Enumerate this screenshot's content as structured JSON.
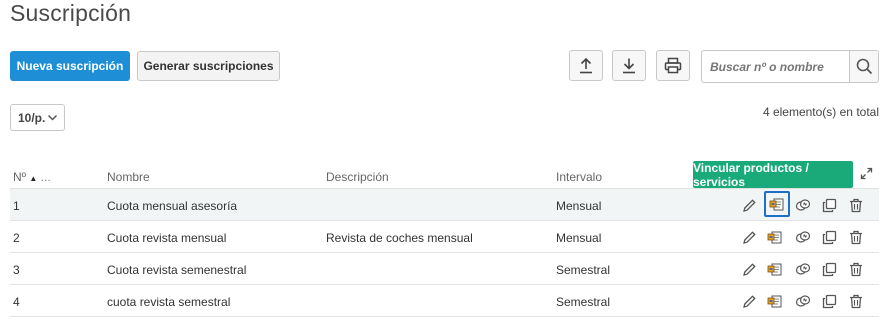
{
  "page": {
    "title": "Suscripción"
  },
  "toolbar": {
    "new_label": "Nueva suscripción",
    "generate_label": "Generar suscripciones",
    "search_placeholder": "Buscar nº o nombre"
  },
  "pagination": {
    "page_size": "10/p.",
    "total_text": "4 elemento(s) en total"
  },
  "table": {
    "headers": {
      "num": "Nº",
      "name": "Nombre",
      "description": "Descripción",
      "interval": "Intervalo"
    },
    "num_sort_extra": "...",
    "tooltip": "Vincular productos / servicios",
    "rows": [
      {
        "num": "1",
        "name": "Cuota mensual asesoría",
        "description": "",
        "interval": "Mensual"
      },
      {
        "num": "2",
        "name": "Cuota revista mensual",
        "description": "Revista de coches mensual",
        "interval": "Mensual"
      },
      {
        "num": "3",
        "name": "Cuota revista semenestral",
        "description": "",
        "interval": "Semestral"
      },
      {
        "num": "4",
        "name": "cuota revista semestral",
        "description": "",
        "interval": "Semestral"
      }
    ]
  },
  "colors": {
    "primary": "#1e8fd6",
    "tooltip": "#1aaa7a",
    "highlight": "#1e6fc8"
  },
  "icons": [
    "upload-icon",
    "download-icon",
    "print-icon",
    "search-icon",
    "chevron-down-icon",
    "expand-icon",
    "edit-icon",
    "link-products-icon",
    "payments-icon",
    "duplicate-icon",
    "delete-icon"
  ]
}
